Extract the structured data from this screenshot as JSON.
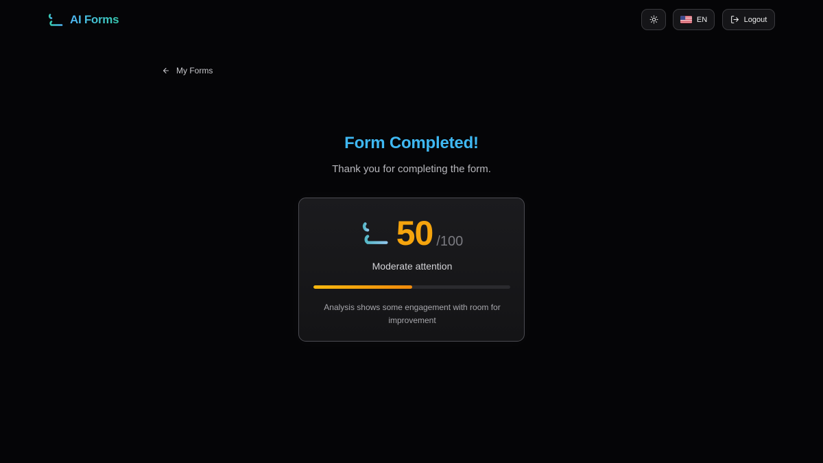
{
  "app": {
    "name": "AI Forms"
  },
  "header": {
    "language": "EN",
    "logout_label": "Logout",
    "icons": [
      "brand-logo-icon",
      "sun-icon",
      "us-flag-icon",
      "logout-icon"
    ]
  },
  "nav": {
    "back_label": "My Forms",
    "back_icon": "arrow-left-icon"
  },
  "result": {
    "title": "Form Completed!",
    "subtitle": "Thank you for completing the form.",
    "score": "50",
    "score_max": "/100",
    "score_fraction": 0.5,
    "level": "Moderate attention",
    "analysis": "Analysis shows some engagement with room for improvement"
  },
  "colors": {
    "accent_blue": "#3fb8f2",
    "accent_teal": "#37c9b0",
    "score_orange": "#f5a40d",
    "background": "#050507"
  }
}
